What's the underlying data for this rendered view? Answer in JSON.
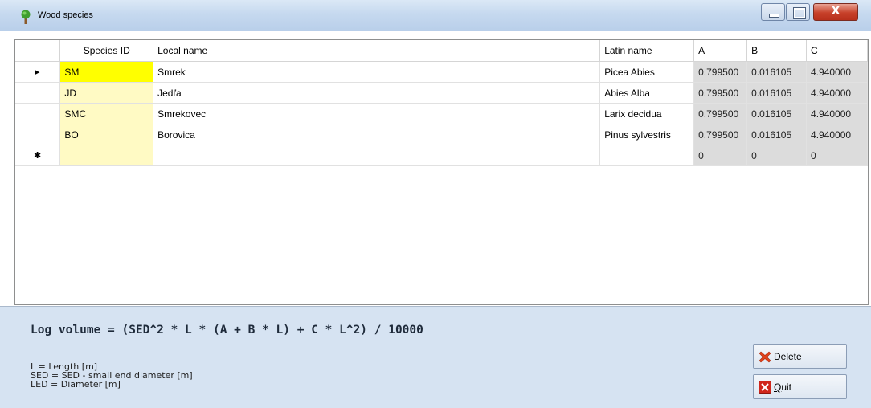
{
  "window": {
    "title": "Wood species",
    "close_glyph": "X"
  },
  "grid": {
    "columns": [
      "Species ID",
      "Local name",
      "Latin name",
      "A",
      "B",
      "C"
    ],
    "rows": [
      {
        "indicator": "▸",
        "id": "SM",
        "local": "Smrek",
        "latin": "Picea Abies",
        "a": "0.799500",
        "b": "0.016105",
        "c": "4.940000"
      },
      {
        "indicator": "",
        "id": "JD",
        "local": "Jedľa",
        "latin": "Abies Alba",
        "a": "0.799500",
        "b": "0.016105",
        "c": "4.940000"
      },
      {
        "indicator": "",
        "id": "SMC",
        "local": "Smrekovec",
        "latin": "Larix decidua",
        "a": "0.799500",
        "b": "0.016105",
        "c": "4.940000"
      },
      {
        "indicator": "",
        "id": "BO",
        "local": "Borovica",
        "latin": "Pinus sylvestris",
        "a": "0.799500",
        "b": "0.016105",
        "c": "4.940000"
      }
    ],
    "new_row": {
      "indicator": "✱",
      "a": "0",
      "b": "0",
      "c": "0"
    }
  },
  "formula": "Log volume = (SED^2 * L * (A + B * L) + C * L^2) / 10000",
  "legend": [
    "L = Length [m]",
    "SED = SED - small end diameter [m]",
    "LED = Diameter [m]"
  ],
  "buttons": {
    "delete": {
      "mnemonic": "D",
      "rest": "elete"
    },
    "quit": {
      "mnemonic": "Q",
      "rest": "uit"
    }
  },
  "colors": {
    "id_cell": "#fffac4",
    "id_selected": "#ffff00",
    "readonly_cell": "#dcdcdc",
    "panel": "#d6e3f2"
  }
}
